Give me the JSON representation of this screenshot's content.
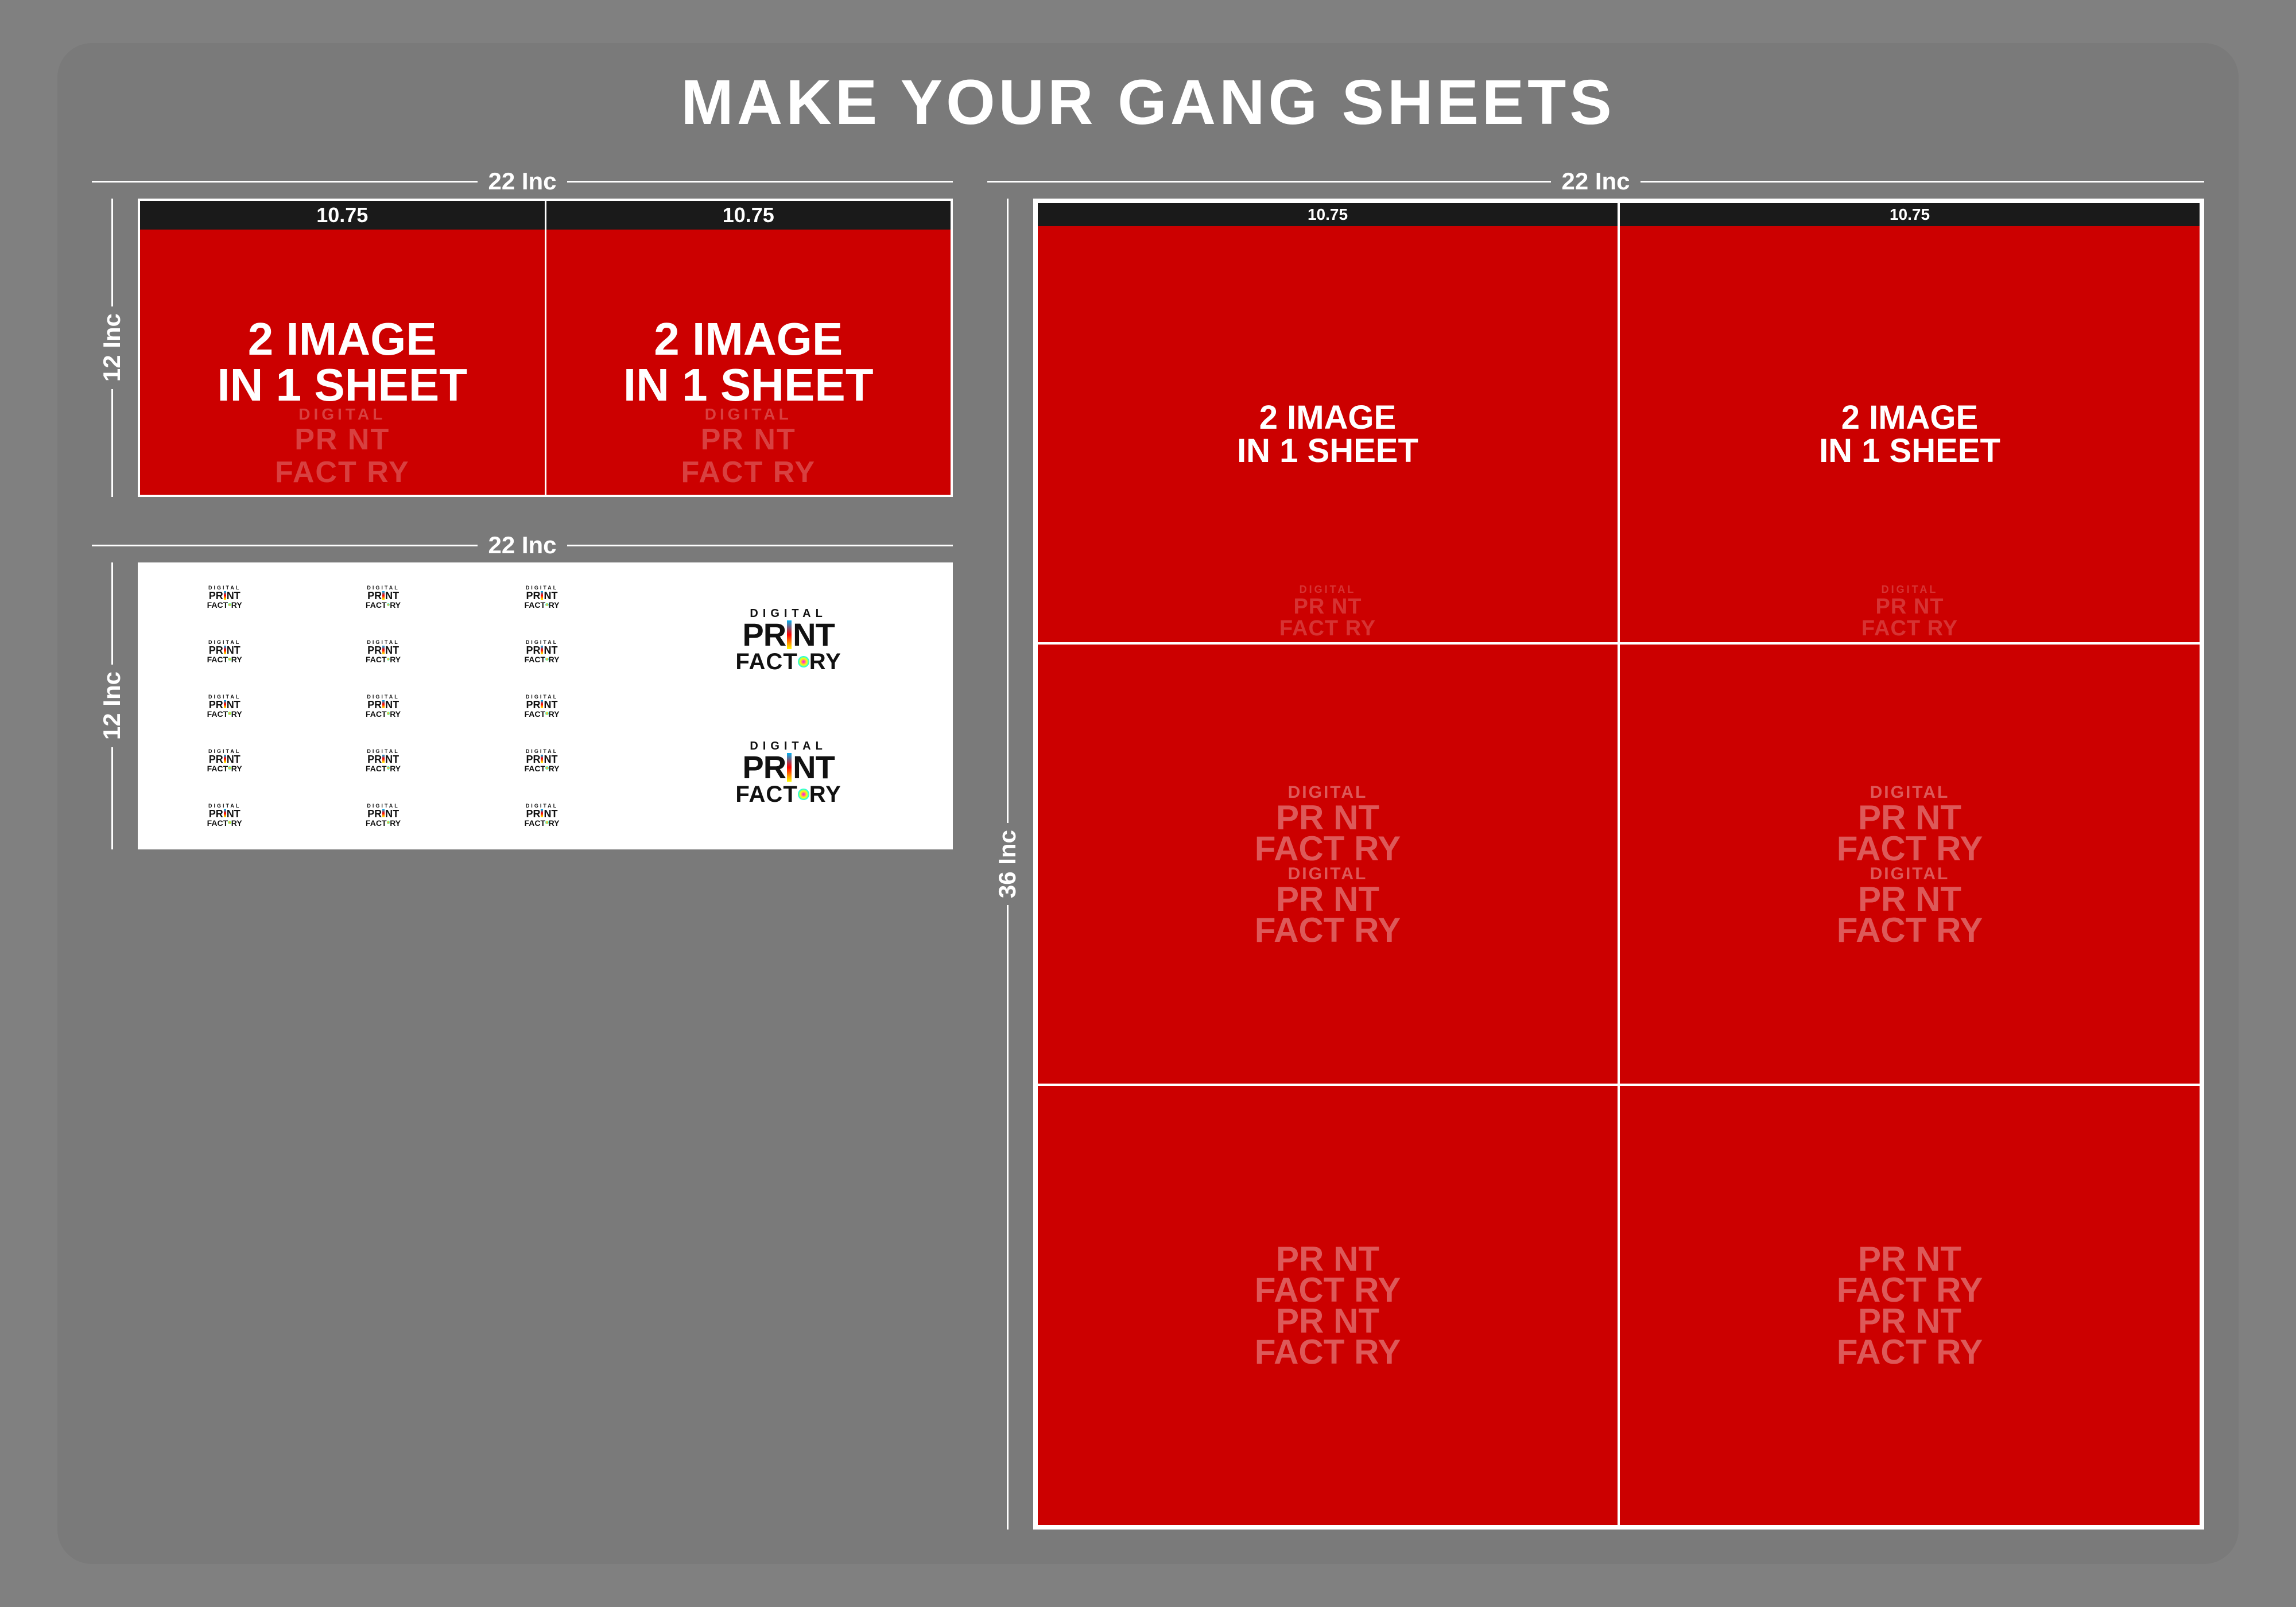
{
  "page": {
    "title": "MAKE YOUR GANG SHEETS",
    "bg_color": "#7a7a7a"
  },
  "left_top_sheet": {
    "width_label": "22 Inc",
    "height_label": "12 Inc",
    "panel1_dim": "10.75",
    "panel2_dim": "10.75",
    "big_text_line1": "2 IMAGE",
    "big_text_line2": "IN 1 SHEET",
    "watermark_print": "PR NT",
    "watermark_factory": "FACT RY",
    "watermark_digital": "DIGITAL"
  },
  "left_bottom_sheet": {
    "width_label": "22 Inc",
    "height_label": "12 Inc",
    "large_logo_digital": "DIGITAL",
    "large_logo_print": "PRINT",
    "large_logo_factory": "FACTORY"
  },
  "right_sheet": {
    "width_label": "22 Inc",
    "height_label": "36 Inc",
    "top_row": {
      "panel1_dim": "10.75",
      "panel2_dim": "10.75",
      "big_text_line1": "2 IMAGE",
      "big_text_line2": "IN 1 SHEET"
    },
    "watermark_print": "PR NT",
    "watermark_factory": "FACT RY",
    "watermark_digital": "DIGITAL"
  },
  "small_logo": {
    "digital": "DIGITAL",
    "print": "PR NT",
    "factory": "FACT RY"
  }
}
